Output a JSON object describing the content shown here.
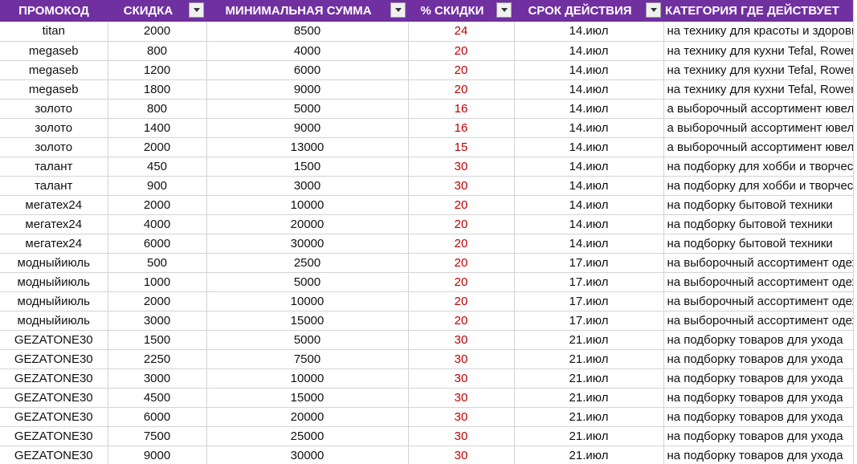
{
  "colors": {
    "header_bg": "#7030a0",
    "header_text": "#ffffff",
    "percent_text": "#c00000"
  },
  "header": {
    "promo": "ПРОМОКОД",
    "discount": "СКИДКА",
    "min_sum": "МИНИМАЛЬНАЯ СУММА",
    "percent": "% СКИДКИ",
    "valid_until": "СРОК ДЕЙСТВИЯ",
    "category": "КАТЕГОРИЯ ГДЕ ДЕЙСТВУЕТ"
  },
  "rows": [
    [
      "titan",
      "2000",
      "8500",
      "24",
      "14.июл",
      "на технику для красоты и здоровья"
    ],
    [
      "megaseb",
      "800",
      "4000",
      "20",
      "14.июл",
      "на технику для кухни Tefal, Rowenta"
    ],
    [
      "megaseb",
      "1200",
      "6000",
      "20",
      "14.июл",
      "на технику для кухни Tefal, Rowenta"
    ],
    [
      "megaseb",
      "1800",
      "9000",
      "20",
      "14.июл",
      "на технику для кухни Tefal, Rowenta"
    ],
    [
      "золото",
      "800",
      "5000",
      "16",
      "14.июл",
      "а выборочный ассортимент ювелирных"
    ],
    [
      "золото",
      "1400",
      "9000",
      "16",
      "14.июл",
      "а выборочный ассортимент ювелирных"
    ],
    [
      "золото",
      "2000",
      "13000",
      "15",
      "14.июл",
      "а выборочный ассортимент ювелирных"
    ],
    [
      "талант",
      "450",
      "1500",
      "30",
      "14.июл",
      "на подборку для хобби и творчества"
    ],
    [
      "талант",
      "900",
      "3000",
      "30",
      "14.июл",
      "на подборку для хобби и творчества"
    ],
    [
      "мегатех24",
      "2000",
      "10000",
      "20",
      "14.июл",
      "на подборку бытовой техники"
    ],
    [
      "мегатех24",
      "4000",
      "20000",
      "20",
      "14.июл",
      "на подборку бытовой техники"
    ],
    [
      "мегатех24",
      "6000",
      "30000",
      "20",
      "14.июл",
      "на подборку бытовой техники"
    ],
    [
      "модныйиюль",
      "500",
      "2500",
      "20",
      "17.июл",
      "на выборочный ассортимент одежды"
    ],
    [
      "модныйиюль",
      "1000",
      "5000",
      "20",
      "17.июл",
      "на выборочный ассортимент одежды"
    ],
    [
      "модныйиюль",
      "2000",
      "10000",
      "20",
      "17.июл",
      "на выборочный ассортимент одежды"
    ],
    [
      "модныйиюль",
      "3000",
      "15000",
      "20",
      "17.июл",
      "на выборочный ассортимент одежды"
    ],
    [
      "GEZATONE30",
      "1500",
      "5000",
      "30",
      "21.июл",
      " на подборку товаров для ухода"
    ],
    [
      "GEZATONE30",
      "2250",
      "7500",
      "30",
      "21.июл",
      " на подборку товаров для ухода"
    ],
    [
      "GEZATONE30",
      "3000",
      "10000",
      "30",
      "21.июл",
      " на подборку товаров для ухода"
    ],
    [
      "GEZATONE30",
      "4500",
      "15000",
      "30",
      "21.июл",
      " на подборку товаров для ухода"
    ],
    [
      "GEZATONE30",
      "6000",
      "20000",
      "30",
      "21.июл",
      " на подборку товаров для ухода"
    ],
    [
      "GEZATONE30",
      "7500",
      "25000",
      "30",
      "21.июл",
      " на подборку товаров для ухода"
    ],
    [
      "GEZATONE30",
      "9000",
      "30000",
      "30",
      "21.июл",
      " на подборку товаров для ухода"
    ]
  ]
}
